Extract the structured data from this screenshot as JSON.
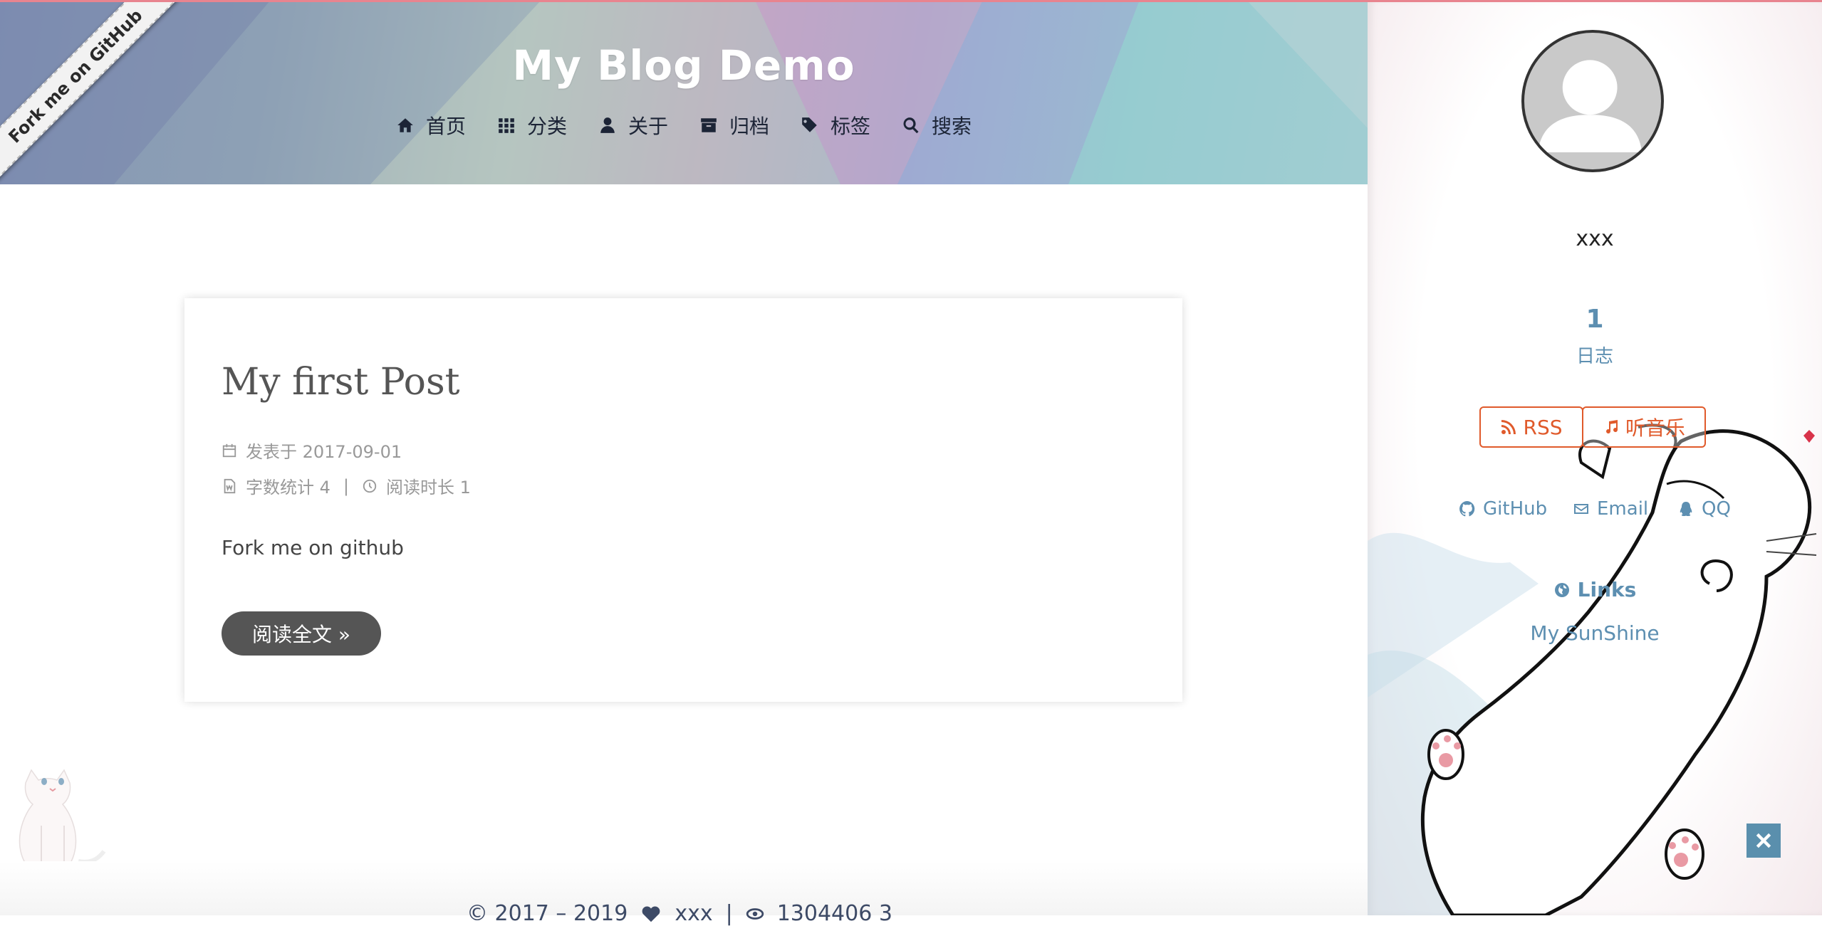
{
  "header": {
    "site_title": "My Blog Demo",
    "nav": [
      {
        "label": "首页",
        "icon": "home-icon"
      },
      {
        "label": "分类",
        "icon": "th-icon"
      },
      {
        "label": "关于",
        "icon": "user-icon"
      },
      {
        "label": "归档",
        "icon": "archive-icon"
      },
      {
        "label": "标签",
        "icon": "tags-icon"
      },
      {
        "label": "搜索",
        "icon": "search-icon"
      }
    ]
  },
  "ribbon": {
    "label": "Fork me on GitHub"
  },
  "post": {
    "title": "My first Post",
    "posted": "发表于 2017-09-01",
    "word_count": "字数统计 4",
    "separator": "|",
    "read_time": "阅读时长 1",
    "excerpt": "Fork me on github",
    "read_more": "阅读全文 »"
  },
  "footer": {
    "copyright": "© 2017 – 2019",
    "author": "xxx",
    "separator": "|",
    "counter": "1304406 3"
  },
  "sidebar": {
    "author": "xxx",
    "posts_count": "1",
    "posts_label": "日志",
    "rss_label": "RSS",
    "music_label": "听音乐",
    "social": [
      {
        "label": "GitHub",
        "icon": "github-icon"
      },
      {
        "label": "Email",
        "icon": "envelope-icon"
      },
      {
        "label": "QQ",
        "icon": "qq-icon"
      }
    ],
    "links_title": "Links",
    "links": [
      "My SunShine"
    ]
  },
  "colors": {
    "accent": "#5d8fb1",
    "feed": "#e05a2b",
    "nav_text": "#1c2436",
    "topline": "#e8848f"
  }
}
